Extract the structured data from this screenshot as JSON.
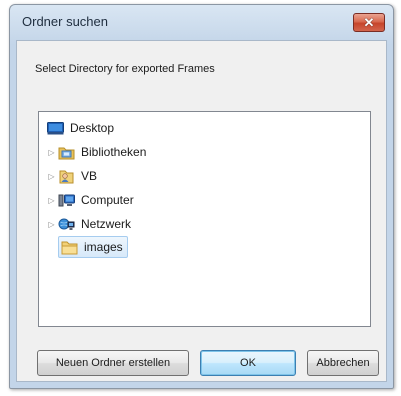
{
  "window": {
    "title": "Ordner suchen",
    "close_symbol": "✕"
  },
  "instruction": "Select Directory for exported Frames",
  "tree": {
    "items": [
      {
        "label": "Desktop",
        "icon": "desktop-icon",
        "expander": "",
        "selected": false
      },
      {
        "label": "Bibliotheken",
        "icon": "libraries-icon",
        "expander": "▷",
        "selected": false
      },
      {
        "label": "VB",
        "icon": "user-folder-icon",
        "expander": "▷",
        "selected": false
      },
      {
        "label": "Computer",
        "icon": "computer-icon",
        "expander": "▷",
        "selected": false
      },
      {
        "label": "Netzwerk",
        "icon": "network-icon",
        "expander": "▷",
        "selected": false
      },
      {
        "label": "images",
        "icon": "folder-icon",
        "expander": "",
        "selected": true
      }
    ]
  },
  "buttons": {
    "new_folder": "Neuen Ordner erstellen",
    "ok": "OK",
    "cancel": "Abbrechen"
  },
  "colors": {
    "selection": "#d7e9f9",
    "close_button": "#c6452b",
    "default_button_border": "#3c7fb1"
  }
}
